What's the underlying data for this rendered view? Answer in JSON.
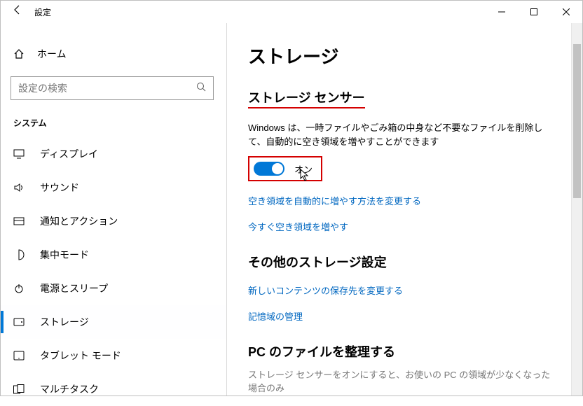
{
  "window": {
    "title": "設定"
  },
  "sidebar": {
    "home": "ホーム",
    "search_placeholder": "設定の検索",
    "group": "システム",
    "items": [
      {
        "label": "ディスプレイ"
      },
      {
        "label": "サウンド"
      },
      {
        "label": "通知とアクション"
      },
      {
        "label": "集中モード"
      },
      {
        "label": "電源とスリープ"
      },
      {
        "label": "ストレージ"
      },
      {
        "label": "タブレット モード"
      },
      {
        "label": "マルチタスク"
      }
    ]
  },
  "main": {
    "title": "ストレージ",
    "sensor_head": "ストレージ センサー",
    "sensor_desc": "Windows は、一時ファイルやごみ箱の中身など不要なファイルを削除して、自動的に空き領域を増やすことができます",
    "toggle_state": "オン",
    "link_change": "空き領域を自動的に増やす方法を変更する",
    "link_now": "今すぐ空き領域を増やす",
    "other_head": "その他のストレージ設定",
    "link_newcontent": "新しいコンテンツの保存先を変更する",
    "link_manage": "記憶域の管理",
    "organize_head": "PC のファイルを整理する",
    "organize_desc": "ストレージ センサーをオンにすると、お使いの PC の領域が少なくなった場合のみ"
  }
}
